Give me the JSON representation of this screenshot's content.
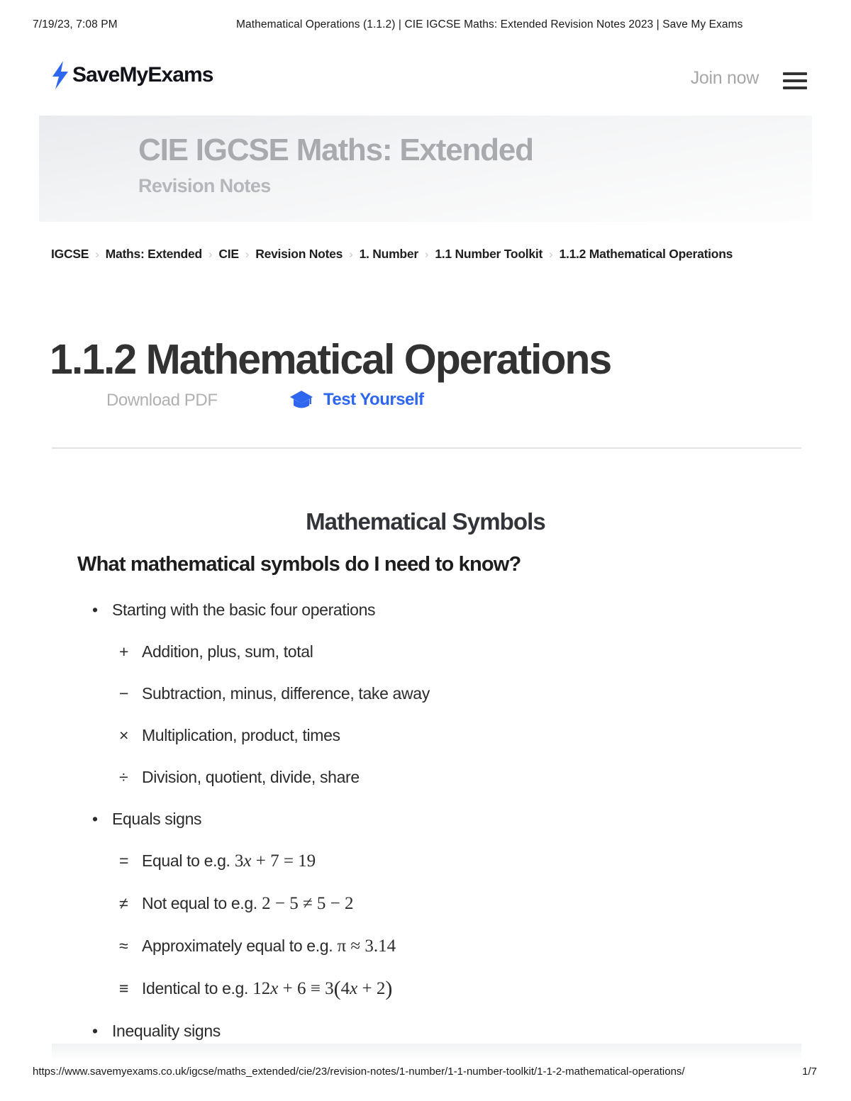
{
  "print_header": {
    "date": "7/19/23, 7:08 PM",
    "doc_title": "Mathematical Operations (1.1.2) | CIE IGCSE Maths: Extended Revision Notes 2023 | Save My Exams"
  },
  "site_nav": {
    "logo_text": "SaveMyExams",
    "logo_icon": "lightning-bolt-icon",
    "join_label": "Join now",
    "menu_icon": "hamburger-menu-icon",
    "brand_color": "#2f66f0"
  },
  "course_banner": {
    "title": "CIE IGCSE Maths: Extended",
    "subtitle": "Revision Notes"
  },
  "breadcrumb": {
    "separator": "›",
    "items": [
      "IGCSE",
      "Maths: Extended",
      "CIE",
      "Revision Notes",
      "1. Number",
      "1.1 Number Toolkit",
      "1.1.2 Mathematical Operations"
    ]
  },
  "page": {
    "title": "1.1.2 Mathematical Operations"
  },
  "actions": {
    "download_label": "Download PDF",
    "test_label": "Test Yourself",
    "test_icon": "graduation-cap-icon",
    "test_color": "#2f66f0"
  },
  "content": {
    "section_heading": "Mathematical Symbols",
    "sub_heading": "What mathematical symbols do I need to know?",
    "blocks": [
      {
        "bullet": "•",
        "text": "Starting with the basic four operations",
        "children": [
          {
            "symbol": "+",
            "text": "Addition, plus, sum, total"
          },
          {
            "symbol": "−",
            "text": "Subtraction, minus, difference, take away"
          },
          {
            "symbol": "×",
            "text": "Multiplication, product, times"
          },
          {
            "symbol": "÷",
            "text": "Division, quotient, divide, share"
          }
        ]
      },
      {
        "bullet": "•",
        "text": "Equals signs",
        "children": [
          {
            "symbol": "=",
            "text": "Equal to e.g.",
            "math": "3x + 7 = 19"
          },
          {
            "symbol": "≠",
            "text": "Not equal to e.g.",
            "math": "2 − 5 ≠ 5 − 2"
          },
          {
            "symbol": "≈",
            "text": "Approximately equal to e.g.",
            "math": "π ≈ 3.14"
          },
          {
            "symbol": "≡",
            "text": "Identical to e.g.",
            "math": "12x + 6 ≡ 3(4x + 2)"
          }
        ]
      },
      {
        "bullet": "•",
        "text": "Inequality signs",
        "children": []
      }
    ]
  },
  "print_footer": {
    "url": "https://www.savemyexams.co.uk/igcse/maths_extended/cie/23/revision-notes/1-number/1-1-number-toolkit/1-1-2-mathematical-operations/",
    "page_number": "1/7"
  }
}
